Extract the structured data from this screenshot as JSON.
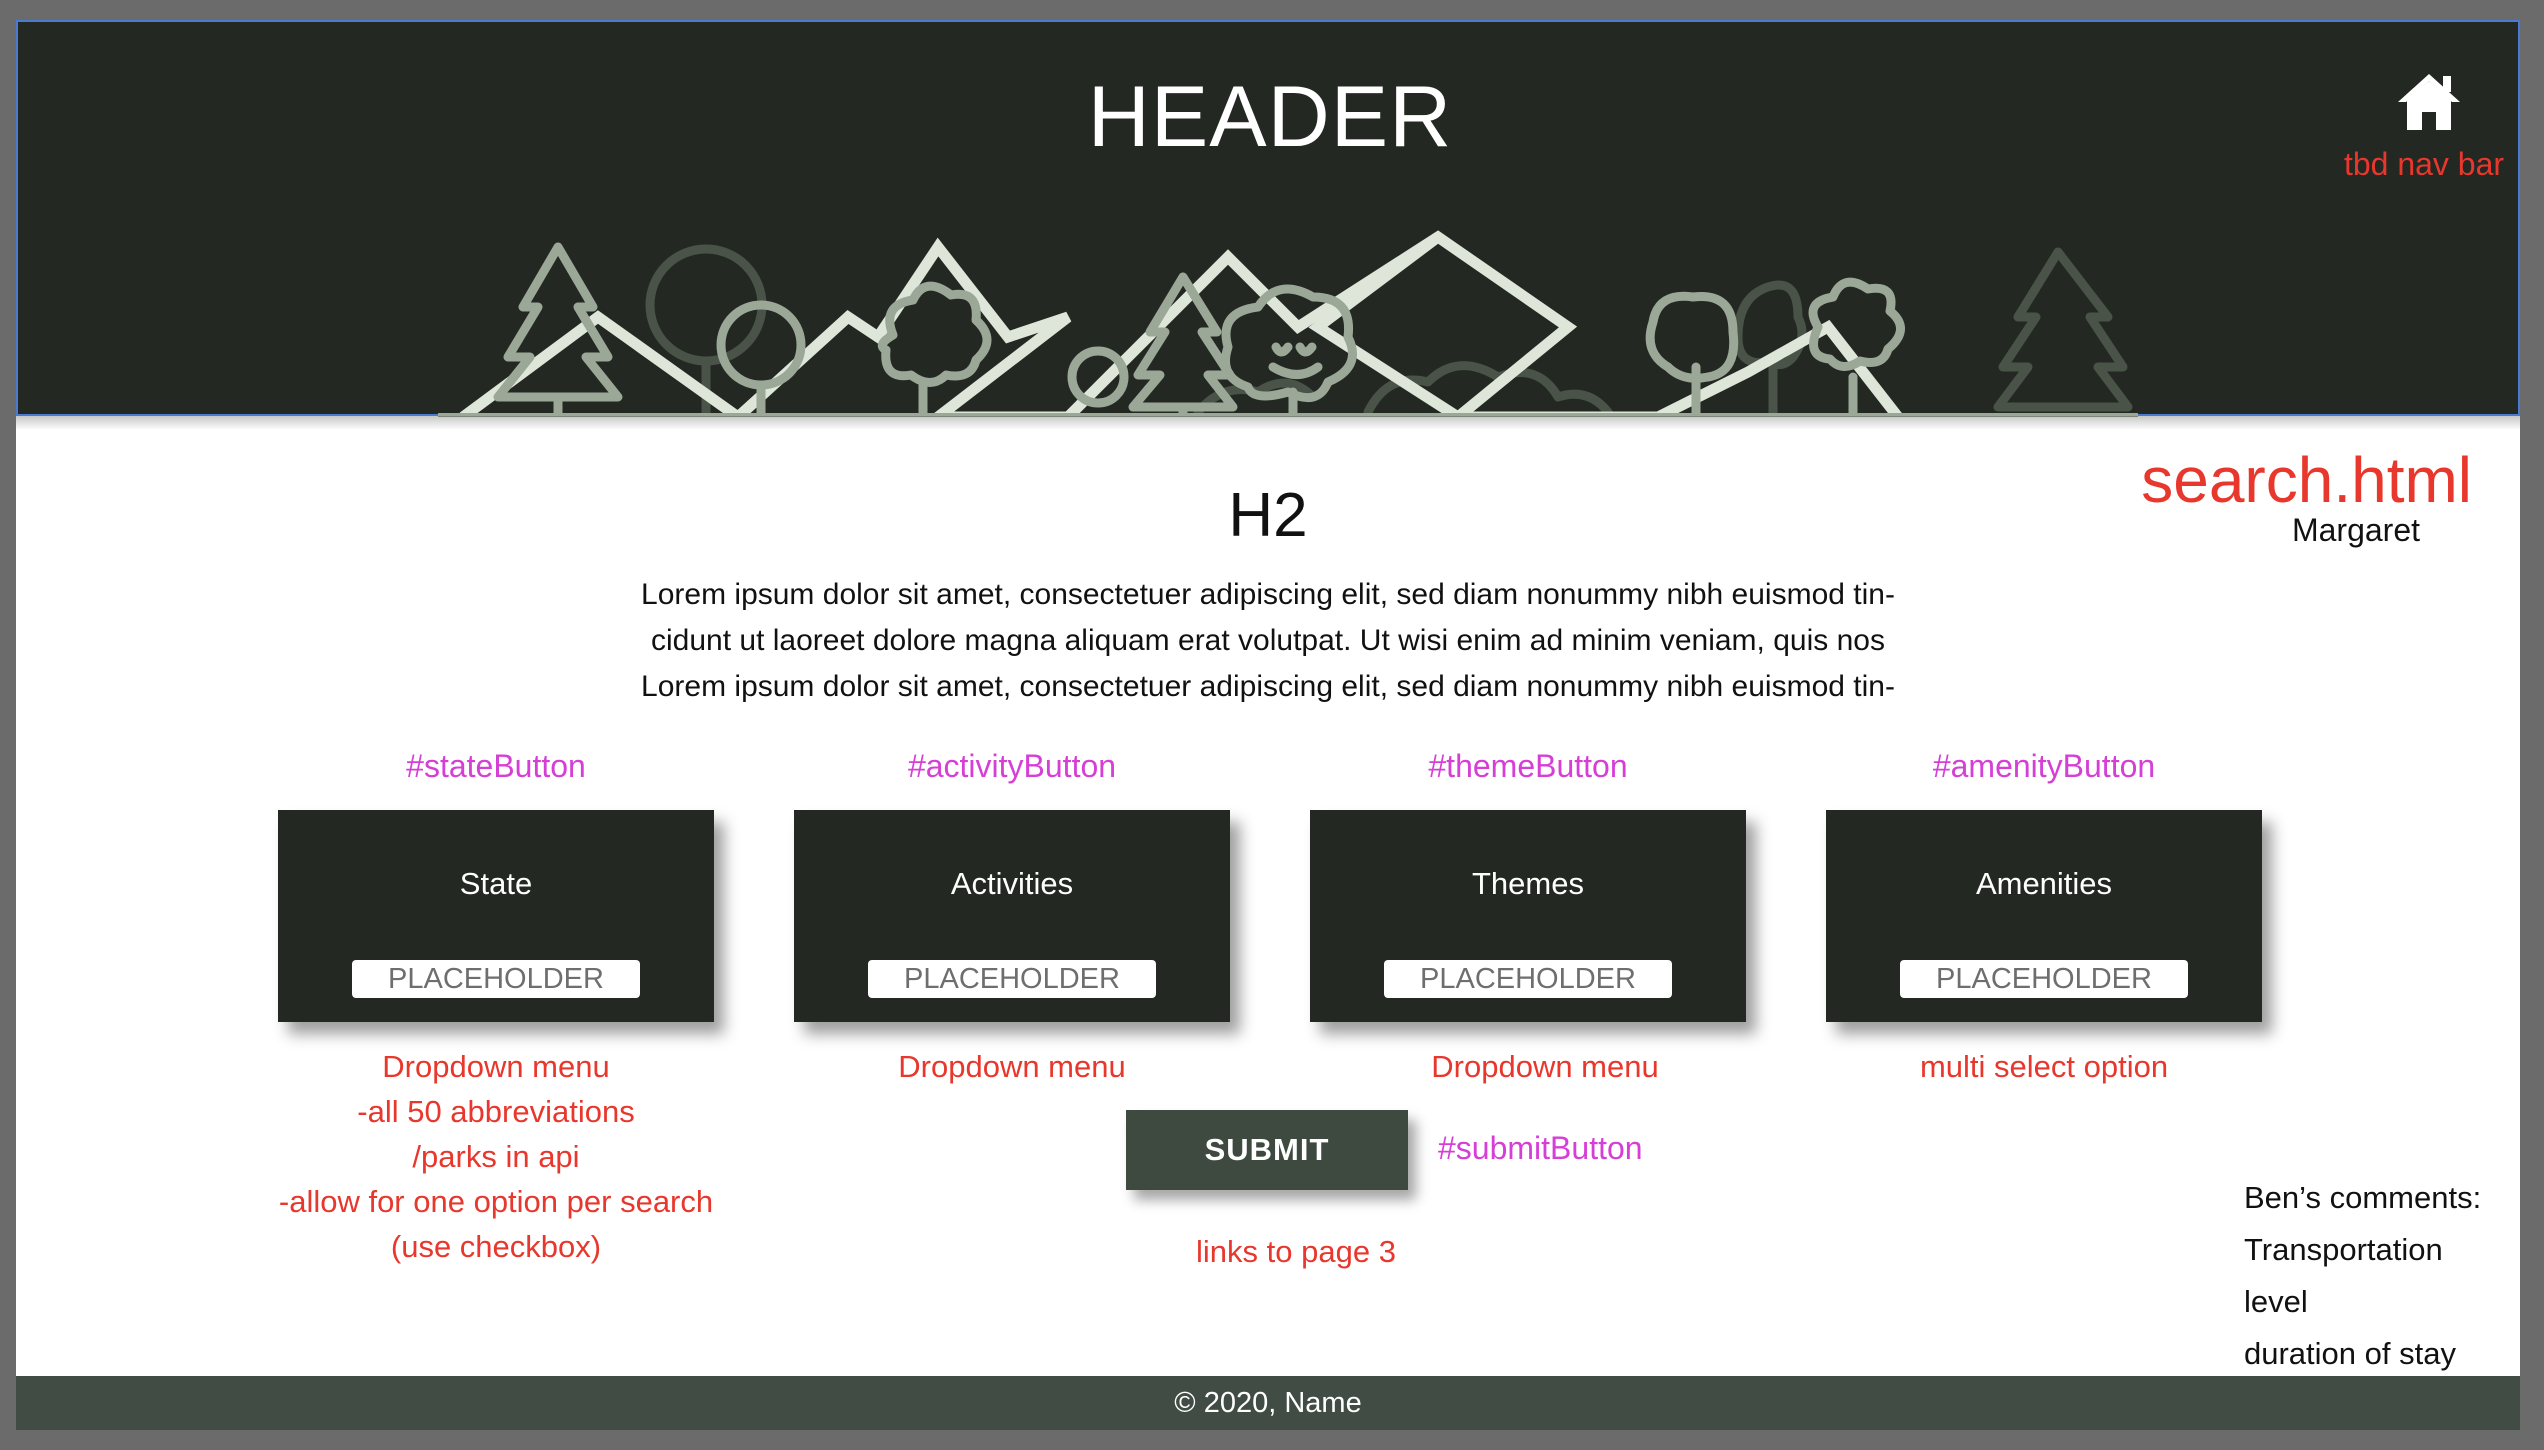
{
  "header": {
    "title": "HEADER",
    "home_icon": "home-icon",
    "nav_note": "tbd nav bar"
  },
  "page_note": "search.html",
  "author": "Margaret",
  "main": {
    "heading": "H2",
    "intro": [
      "Lorem ipsum dolor sit amet, consectetuer adipiscing elit, sed diam nonummy nibh euismod tin-",
      "cidunt ut laoreet dolore magna aliquam erat volutpat. Ut wisi enim ad minim veniam, quis nos",
      "Lorem ipsum dolor sit amet, consectetuer adipiscing elit, sed diam nonummy nibh euismod tin-"
    ]
  },
  "filters": [
    {
      "id_label": "#stateButton",
      "label": "State",
      "placeholder": "PLACEHOLDER",
      "notes": [
        "Dropdown menu",
        "-all 50 abbreviations",
        "/parks in api",
        "-allow for one option per search",
        "(use checkbox)"
      ]
    },
    {
      "id_label": "#activityButton",
      "label": "Activities",
      "placeholder": "PLACEHOLDER",
      "notes": [
        "Dropdown menu"
      ]
    },
    {
      "id_label": "#themeButton",
      "label": "Themes",
      "placeholder": "PLACEHOLDER",
      "notes": [
        "Dropdown menu"
      ]
    },
    {
      "id_label": "#amenityButton",
      "label": "Amenities",
      "placeholder": "PLACEHOLDER",
      "notes": [
        "multi select option"
      ]
    }
  ],
  "submit": {
    "label": "SUBMIT",
    "id_label": "#submitButton",
    "note": "links to page 3"
  },
  "comments": {
    "title": "Ben’s comments:",
    "items": [
      "Transportation",
      "level",
      "duration of stay"
    ]
  },
  "footer": {
    "text": "© 2020, Name"
  },
  "colors": {
    "dark": "#242823",
    "footer": "#414c45",
    "note_red": "#e8372c",
    "id_magenta": "#d63fd6",
    "scene_light": "#dde6d8",
    "scene_mid": "#9ba797",
    "scene_dark": "#4a5348"
  }
}
